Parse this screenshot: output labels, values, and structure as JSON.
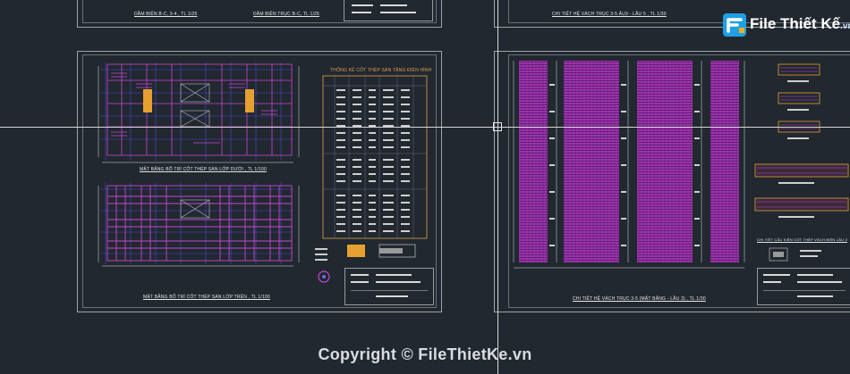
{
  "app": {
    "type": "cad-drawing-viewer"
  },
  "top_captions": {
    "left_a": "DẦM BIÊN B-C, 3-4 , TL 1/25",
    "left_b": "DẦM BIÊN TRỤC B-C, TL 1/25",
    "right": "CHI TIẾT HỆ VÁCH TRỤC 3-5 ẢU3 - LẦU 5 , TL 1/30"
  },
  "left_sheet": {
    "plan_top_caption": "MẶT BẰNG BỐ TRÍ CỐT THÉP SÀN LỚP DƯỚI , TL 1/100",
    "plan_bottom_caption": "MẶT BẰNG BỐ TRÍ CỐT THÉP SÀN LỚP TRÊN , TL 1/100",
    "table_title": "THỐNG KÊ CỐT THÉP SÀN TẦNG ĐIỂN HÌNH"
  },
  "right_sheet": {
    "bottom_caption": "CHI TIẾT HỆ VÁCH TRỤC 3-5 (MẶT BẰNG - LẦU 3) , TL 1/30",
    "detail_caption": "CHI TIẾT CẤU KIỆN CỐT THÉP VÁCH BIÊN LẦU 3"
  },
  "watermark": {
    "logo_main": "File Thiết Kế",
    "logo_tld": ".vn",
    "copyright": "Copyright © FileThietKe.vn"
  },
  "colors": {
    "background": "#212830",
    "rebar": "#d04ad8",
    "grid": "#6a6af0",
    "frame": "#a0a4a8",
    "logo_blue": "#1fa0e6"
  }
}
